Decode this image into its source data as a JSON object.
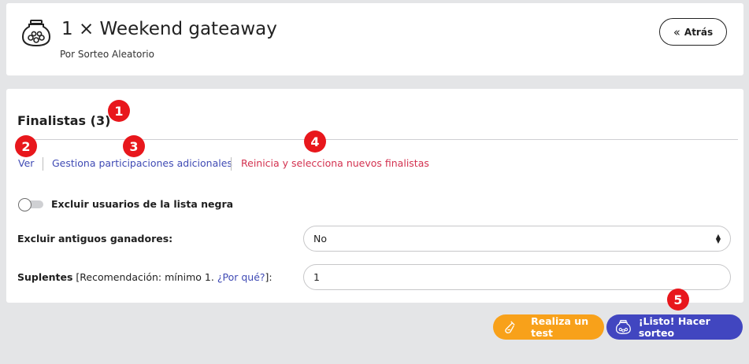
{
  "header": {
    "title": "1 × Weekend gateaway",
    "subtitle": "Por Sorteo Aleatorio",
    "back_label": "Atrás",
    "back_icon": "double-chevron-left"
  },
  "finalists": {
    "title": "Finalistas (3)",
    "links": {
      "view": "Ver",
      "manage": "Gestiona participaciones adicionales",
      "reset": "Reinicia y selecciona nuevos finalistas"
    }
  },
  "options": {
    "blacklist_toggle_label": "Excluir usuarios de la lista negra",
    "blacklist_toggle_on": false,
    "exclude_winners_label": "Excluir antiguos ganadores:",
    "exclude_winners_value": "No",
    "substitutes_label": "Suplentes",
    "substitutes_hint_prefix": "[Recomendación: mínimo 1.",
    "substitutes_hint_link": "¿Por qué?",
    "substitutes_hint_suffix": "]:",
    "substitutes_value": "1"
  },
  "actions": {
    "test_label": "Realiza un test",
    "draw_label": "¡Listo! Hacer sorteo"
  },
  "badges": [
    "1",
    "2",
    "3",
    "4",
    "5"
  ],
  "colors": {
    "link_blue": "#3f4ab4",
    "reset_red": "#d3314f",
    "test_orange": "#f8a11a",
    "draw_blue": "#4146c0",
    "badge_red": "#e8171c"
  }
}
